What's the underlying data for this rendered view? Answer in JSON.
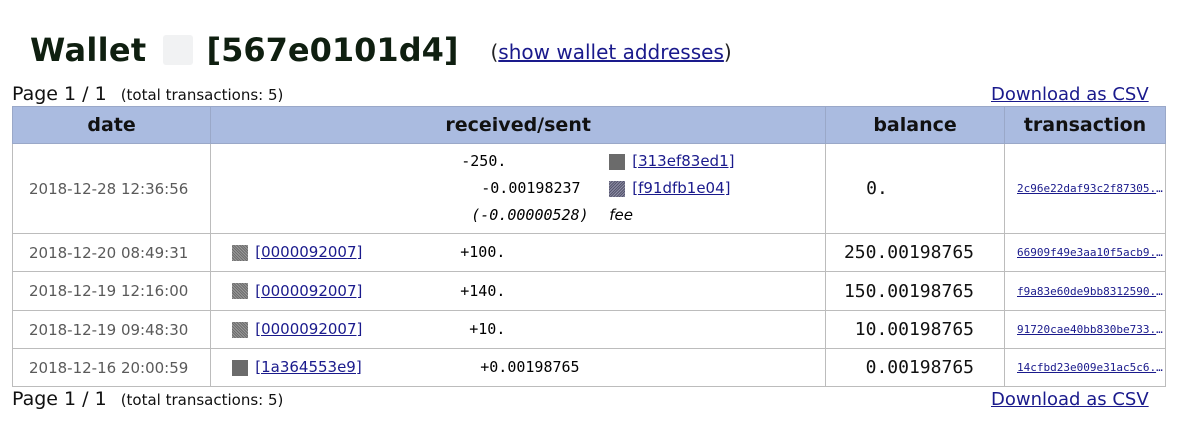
{
  "header": {
    "title": "Wallet",
    "wallet_id": "[567e0101d4]",
    "show_addresses_link": "show wallet addresses",
    "paren_open": "(",
    "paren_close": ")"
  },
  "pager": {
    "page_text": "Page 1 / 1",
    "total_text": "(total transactions: 5)",
    "csv_link": "Download as CSV"
  },
  "table": {
    "columns": [
      "date",
      "received/sent",
      "balance",
      "transaction"
    ],
    "rows": [
      {
        "date": "2018-12-28 12:36:56",
        "lines": [
          {
            "amount": "-250.",
            "ref": "[313ef83ed1]"
          },
          {
            "amount": "-0.00198237",
            "ref": "[f91dfb1e04]"
          }
        ],
        "fee_amount": "(-0.00000528)",
        "fee_label": "fee",
        "balance": "0.",
        "tx": "2c96e22daf93c2f87305..."
      },
      {
        "date": "2018-12-20 08:49:31",
        "ref": "[0000092007]",
        "amount": "+100.",
        "balance": "250.00198765",
        "tx": "66909f49e3aa10f5acb9..."
      },
      {
        "date": "2018-12-19 12:16:00",
        "ref": "[0000092007]",
        "amount": "+140.",
        "balance": "150.00198765",
        "tx": "f9a83e60de9bb8312590..."
      },
      {
        "date": "2018-12-19 09:48:30",
        "ref": "[0000092007]",
        "amount": "+10.",
        "balance": "10.00198765",
        "tx": "91720cae40bb830be733..."
      },
      {
        "date": "2018-12-16 20:00:59",
        "ref": "[1a364553e9]",
        "amount": "+0.00198765",
        "balance": "0.00198765",
        "tx": "14cfbd23e009e31ac5c6..."
      }
    ]
  }
}
